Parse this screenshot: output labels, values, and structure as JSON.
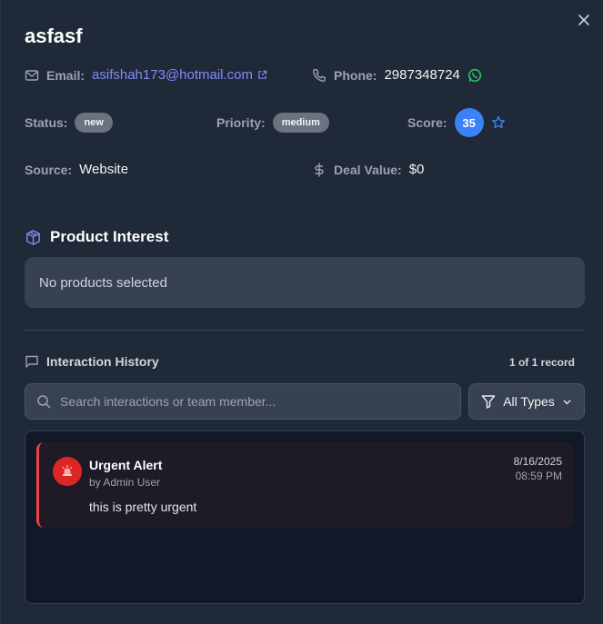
{
  "lead": {
    "name": "asfasf",
    "email_label": "Email:",
    "email": "asifshah173@hotmail.com",
    "phone_label": "Phone:",
    "phone": "2987348724",
    "status_label": "Status:",
    "status": "new",
    "priority_label": "Priority:",
    "priority": "medium",
    "score_label": "Score:",
    "score": "35",
    "source_label": "Source:",
    "source": "Website",
    "deal_value_label": "Deal Value:",
    "deal_value": "$0"
  },
  "product_interest": {
    "title": "Product Interest",
    "empty_text": "No products selected"
  },
  "history": {
    "title": "Interaction History",
    "record_count": "1 of 1 record",
    "search_placeholder": "Search interactions or team member...",
    "filter_label": "All Types",
    "items": [
      {
        "title": "Urgent Alert",
        "by": "by Admin User",
        "body": "this is pretty urgent",
        "date": "8/16/2025",
        "time": "08:59 PM"
      }
    ]
  },
  "colors": {
    "background": "#1f2937",
    "accent_link": "#818cf8",
    "score_badge": "#3b82f6",
    "alert_red": "#ef4444",
    "whatsapp_green": "#22c55e",
    "status_pill": "#6b7280"
  },
  "icons": {
    "close": "close-icon",
    "email": "mail-icon",
    "external": "external-link-icon",
    "phone": "phone-icon",
    "whatsapp": "whatsapp-icon",
    "star": "star-icon",
    "dollar": "dollar-icon",
    "product": "package-icon",
    "history": "message-square-icon",
    "search": "search-icon",
    "filter": "filter-icon",
    "chevron": "chevron-down-icon",
    "alert": "siren-icon"
  }
}
